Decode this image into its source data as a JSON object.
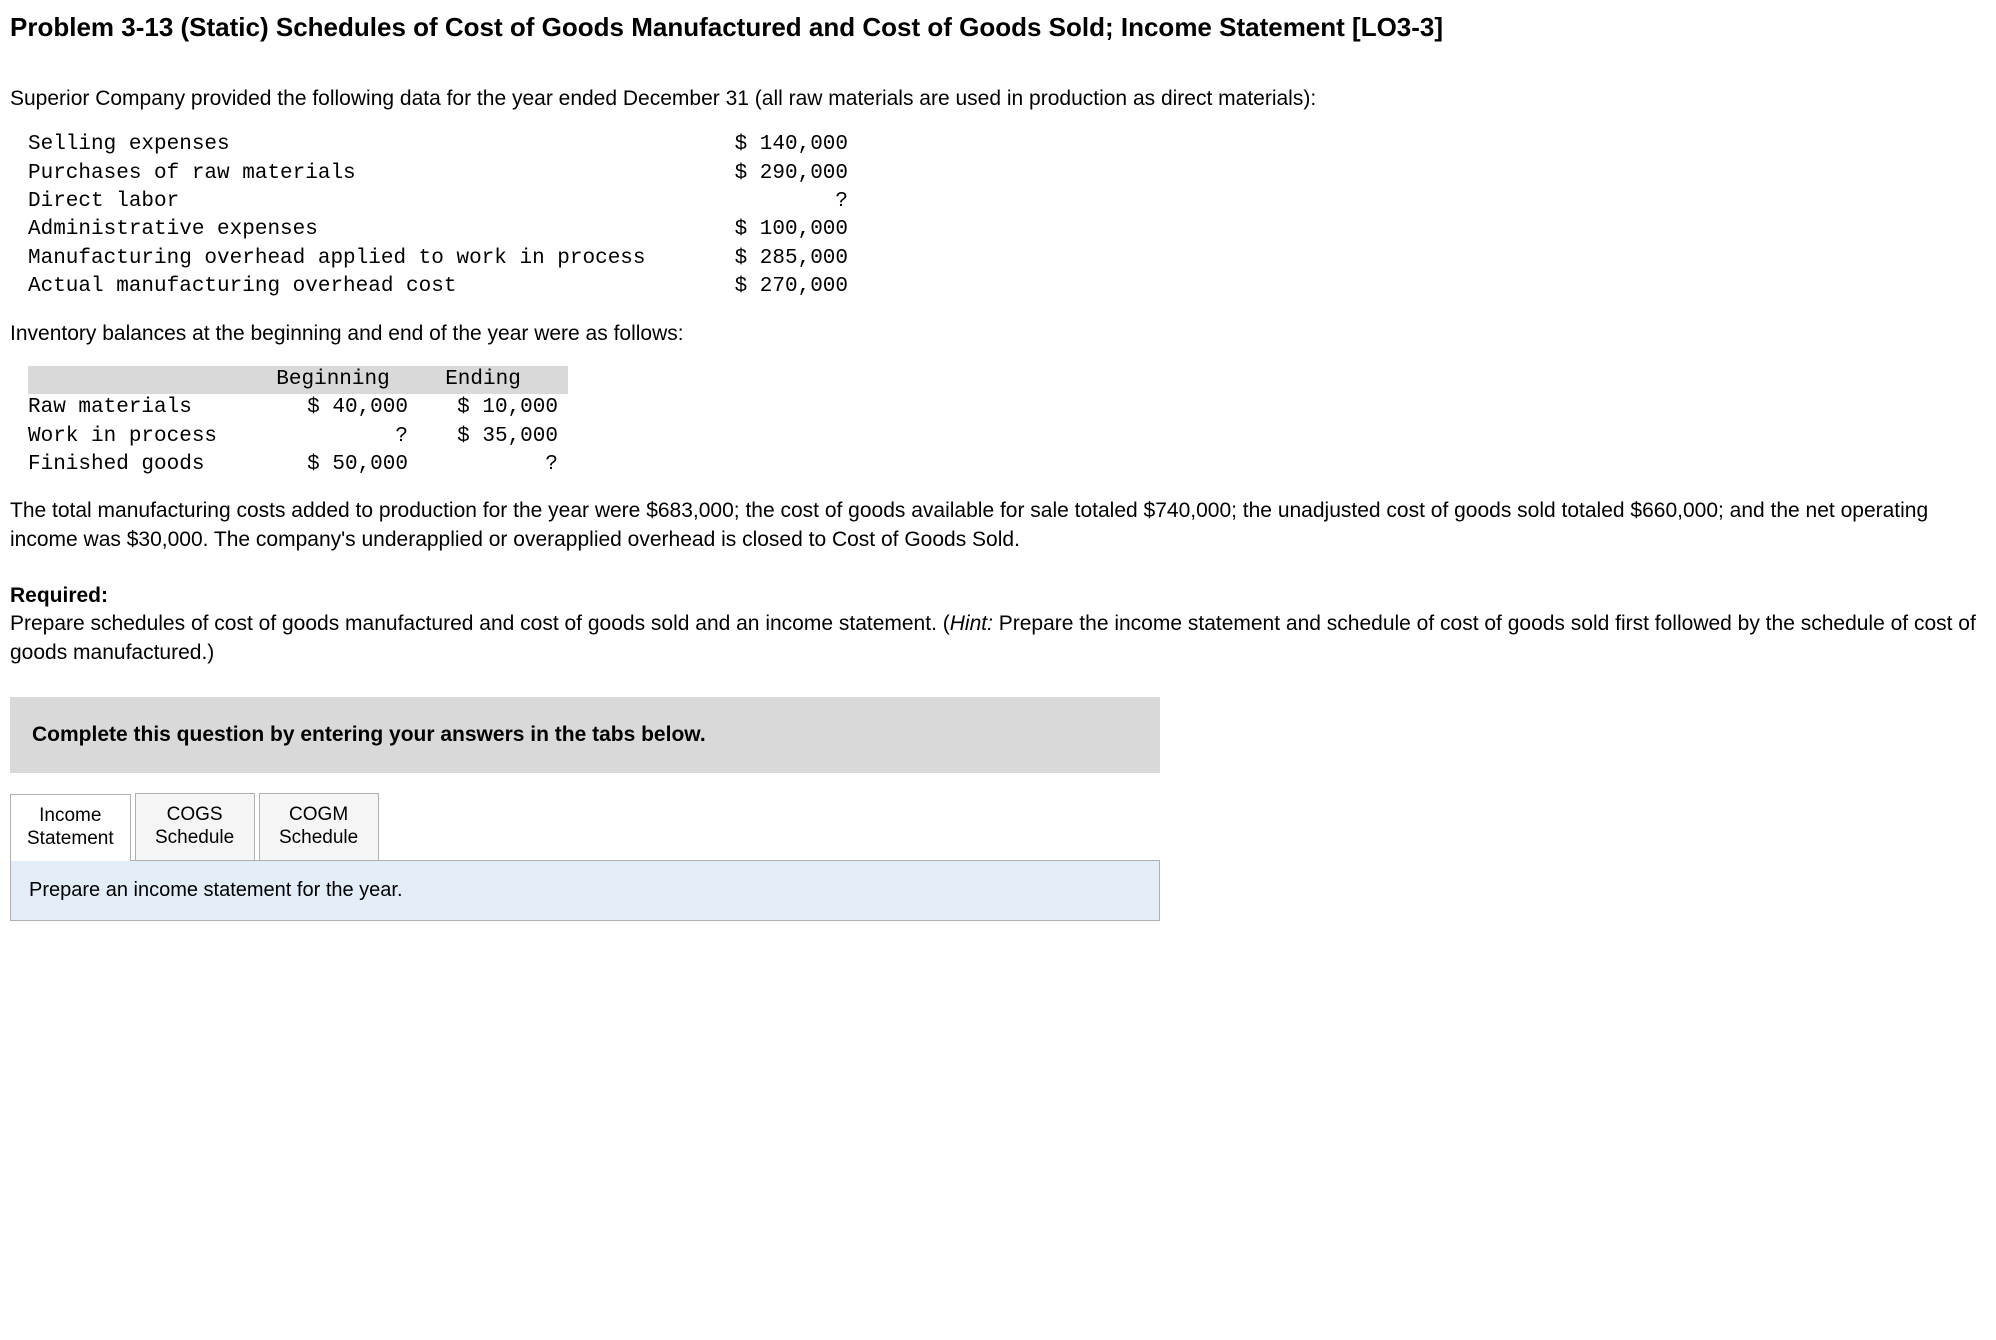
{
  "title": "Problem 3-13 (Static) Schedules of Cost of Goods Manufactured and Cost of Goods Sold; Income Statement [LO3-3]",
  "intro": "Superior Company provided the following data for the year ended December 31 (all raw materials are used in production as direct materials):",
  "data_items": [
    {
      "label": "Selling expenses",
      "value": "$ 140,000"
    },
    {
      "label": "Purchases of raw materials",
      "value": "$ 290,000"
    },
    {
      "label": "Direct labor",
      "value": "?"
    },
    {
      "label": "Administrative expenses",
      "value": "$ 100,000"
    },
    {
      "label": "Manufacturing overhead applied to work in process",
      "value": "$ 285,000"
    },
    {
      "label": "Actual manufacturing overhead cost",
      "value": "$ 270,000"
    }
  ],
  "subhead": "Inventory balances at the beginning and end of the year were as follows:",
  "inv_headers": {
    "col1": "",
    "col2": "Beginning",
    "col3": "Ending"
  },
  "inv_rows": [
    {
      "label": "Raw materials",
      "beginning": "$ 40,000",
      "ending": "$ 10,000"
    },
    {
      "label": "Work in process",
      "beginning": "?",
      "ending": "$ 35,000"
    },
    {
      "label": "Finished goods",
      "beginning": "$ 50,000",
      "ending": "?"
    }
  ],
  "para": "The total manufacturing costs added to production for the year were $683,000; the cost of goods available for sale totaled $740,000; the unadjusted cost of goods sold totaled $660,000; and the net operating income was $30,000. The company's underapplied or overapplied overhead is closed to Cost of Goods Sold.",
  "required_label": "Required:",
  "required_text_1": "Prepare schedules of cost of goods manufactured and cost of goods sold and an income statement. (",
  "hint_label": "Hint:",
  "required_text_2": " Prepare the income statement and schedule of cost of goods sold first followed by the schedule of cost of goods manufactured.)",
  "instruction": "Complete this question by entering your answers in the tabs below.",
  "tabs": [
    {
      "line1": "Income",
      "line2": "Statement",
      "active": true
    },
    {
      "line1": "COGS",
      "line2": "Schedule",
      "active": false
    },
    {
      "line1": "COGM",
      "line2": "Schedule",
      "active": false
    }
  ],
  "tab_content": "Prepare an income statement for the year."
}
